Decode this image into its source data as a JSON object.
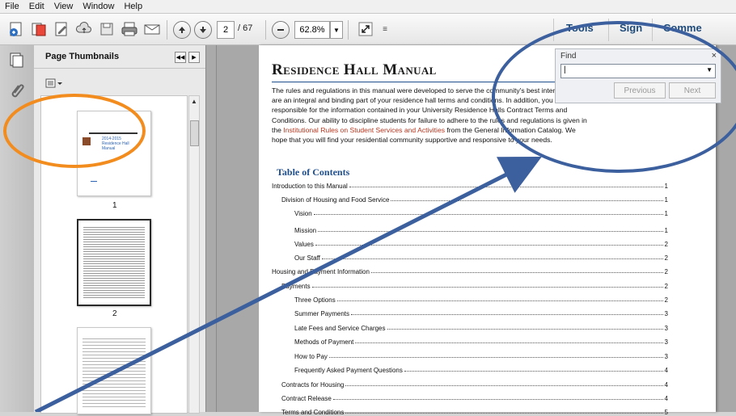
{
  "menu": [
    "File",
    "Edit",
    "View",
    "Window",
    "Help"
  ],
  "toolbar": {
    "page_current": "2",
    "page_total": "/ 67",
    "zoom": "62.8%",
    "links": [
      "Tools",
      "Sign",
      "Comme"
    ]
  },
  "panel": {
    "title": "Page Thumbnails",
    "thumb_labels": [
      "1",
      "2"
    ],
    "thumb1_lines": [
      "2014-2015",
      "Residence Hall",
      "Manual"
    ]
  },
  "document": {
    "title": "Residence Hall Manual",
    "intro": {
      "line1": "The rules and regulations in this manual were developed to serve the community's best interests and",
      "line2": "are an integral and binding part of your residence hall terms and conditions. In addition, you are",
      "line3": "responsible for the information contained in your University Residence Halls Contract Terms and",
      "line4": "Conditions. Our ability to discipline students for failure to adhere to the rules and regulations is given in",
      "line5a": "the ",
      "line5_link": "Institutional Rules on Student Services and Activities",
      "line5b": " from the General Information Catalog. We",
      "line6": "hope that you will find your residential community supportive and responsive to your needs."
    },
    "toc_title": "Table of Contents",
    "toc": [
      {
        "label": "Introduction to this Manual",
        "page": "1"
      },
      {
        "label": "Division of Housing and Food Service",
        "page": "1"
      },
      {
        "label": "Vision",
        "page": "1"
      },
      {
        "label": "Mission",
        "page": "1"
      },
      {
        "label": "Values",
        "page": "2"
      },
      {
        "label": "Our Staff",
        "page": "2"
      },
      {
        "label": "Housing and Payment Information",
        "page": "2"
      },
      {
        "label": "Payments",
        "page": "2"
      },
      {
        "label": "Three Options",
        "page": "2"
      },
      {
        "label": "Summer Payments",
        "page": "3"
      },
      {
        "label": "Late Fees and Service Charges",
        "page": "3"
      },
      {
        "label": "Methods of Payment",
        "page": "3"
      },
      {
        "label": "How to Pay",
        "page": "3"
      },
      {
        "label": "Frequently Asked Payment Questions",
        "page": "4"
      },
      {
        "label": "Contracts for Housing",
        "page": "4"
      },
      {
        "label": "Contract Release",
        "page": "4"
      },
      {
        "label": "Terms and Conditions",
        "page": "5"
      }
    ]
  },
  "find": {
    "title": "Find",
    "close": "×",
    "previous": "Previous",
    "next": "Next"
  },
  "annotations": {
    "orange": "#f28c1e",
    "blue": "#3c5f9e"
  }
}
